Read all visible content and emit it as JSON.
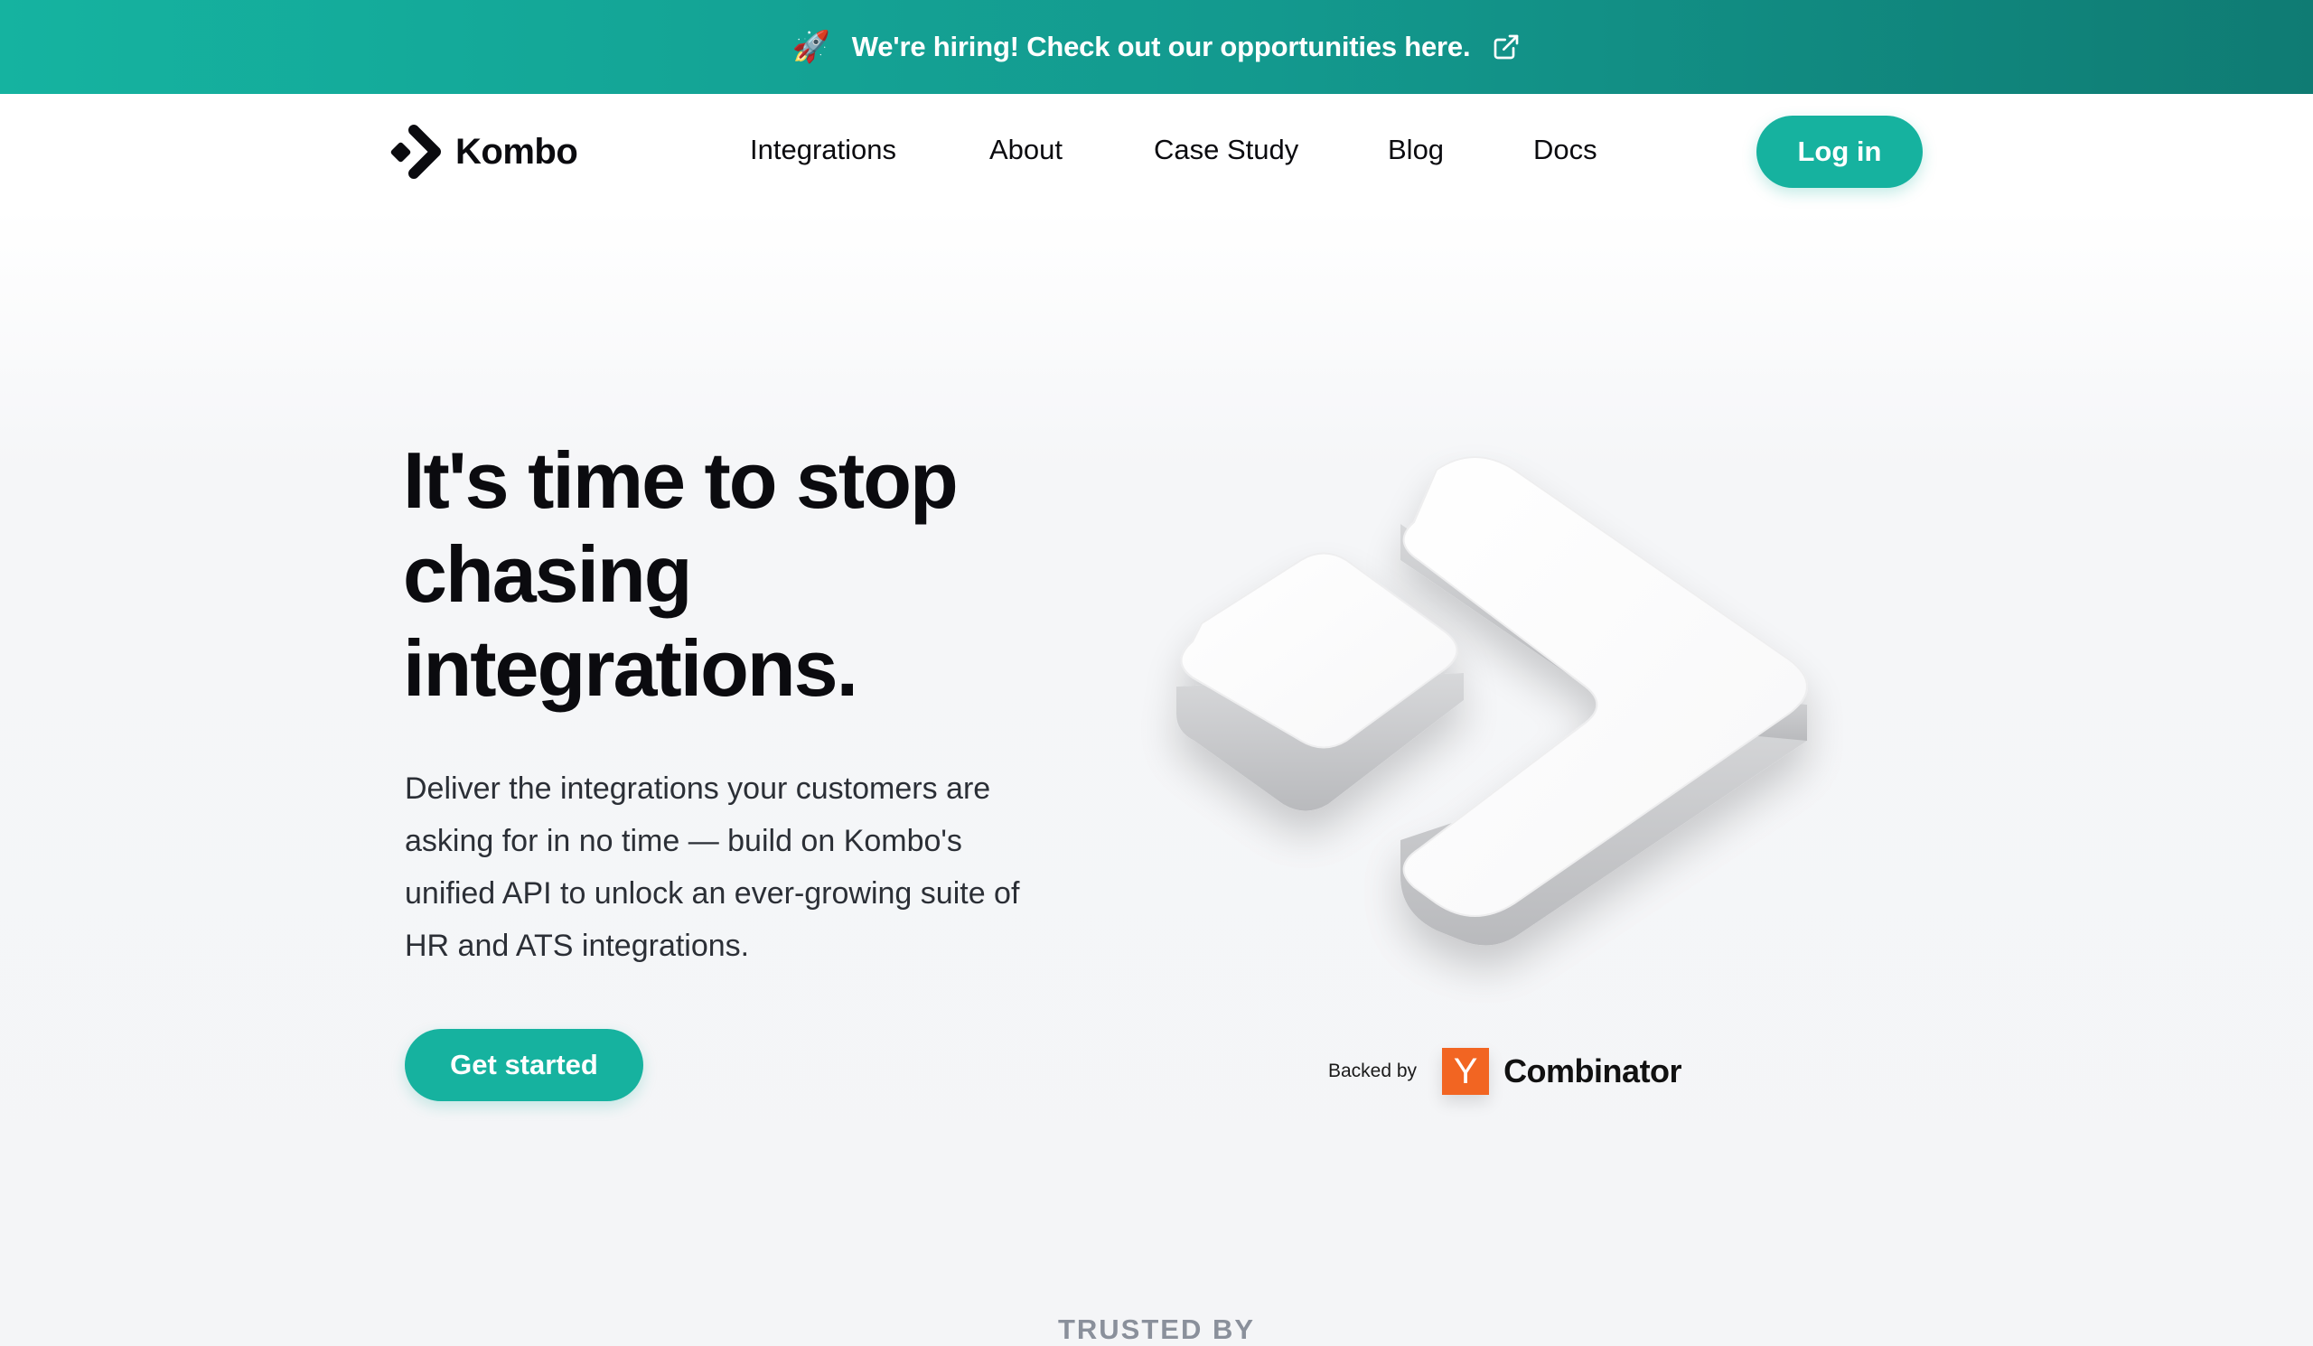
{
  "announcement": {
    "rocket_icon": "🚀",
    "text": "We're hiring! Check out our opportunities here.",
    "icon": "external-link-icon",
    "background_colors": [
      "#15b3a0",
      "#0f7b73"
    ]
  },
  "nav": {
    "brand": "Kombo",
    "links": [
      {
        "label": "Integrations"
      },
      {
        "label": "About"
      },
      {
        "label": "Case Study"
      },
      {
        "label": "Blog"
      },
      {
        "label": "Docs"
      }
    ],
    "login_label": "Log in"
  },
  "hero": {
    "title": "It's time to stop chasing integrations.",
    "description": "Deliver the integrations your customers are asking for in no time — build on Kombo's unified API to unlock an ever-growing suite of HR and ATS integrations.",
    "cta_label": "Get started"
  },
  "backed_by": {
    "label": "Backed by",
    "yc_letter": "Y",
    "name": "Combinator",
    "brand_color": "#f26522"
  },
  "trusted_by": {
    "label": "TRUSTED BY"
  },
  "colors": {
    "accent": "#16b29f",
    "text": "#0b0b0f",
    "muted": "#8a909b"
  }
}
